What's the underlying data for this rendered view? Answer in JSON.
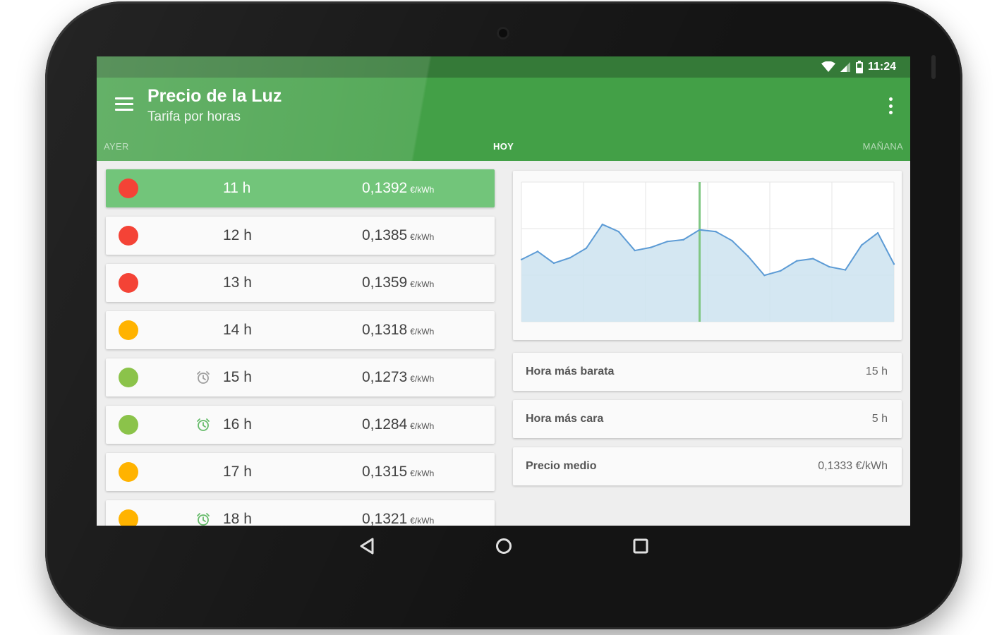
{
  "status_bar": {
    "time": "11:24",
    "icons": [
      "wifi-icon",
      "signal-icon",
      "battery-icon"
    ]
  },
  "app_bar": {
    "title": "Precio de la Luz",
    "subtitle": "Tarifa por horas",
    "menu_icon": "menu-icon",
    "overflow_icon": "more-vert-icon"
  },
  "tabs": [
    {
      "label": "AYER",
      "active": false
    },
    {
      "label": "HOY",
      "active": true
    },
    {
      "label": "MAÑANA",
      "active": false
    }
  ],
  "hours": [
    {
      "hour": "11 h",
      "price": "0,1392",
      "unit": "€/kWh",
      "level_color": "#f44336",
      "alarm": false,
      "selected": true
    },
    {
      "hour": "12 h",
      "price": "0,1385",
      "unit": "€/kWh",
      "level_color": "#f44336",
      "alarm": false,
      "selected": false
    },
    {
      "hour": "13 h",
      "price": "0,1359",
      "unit": "€/kWh",
      "level_color": "#f44336",
      "alarm": false,
      "selected": false
    },
    {
      "hour": "14 h",
      "price": "0,1318",
      "unit": "€/kWh",
      "level_color": "#ffb300",
      "alarm": false,
      "selected": false
    },
    {
      "hour": "15 h",
      "price": "0,1273",
      "unit": "€/kWh",
      "level_color": "#8bc34a",
      "alarm": true,
      "alarm_active": false,
      "selected": false
    },
    {
      "hour": "16 h",
      "price": "0,1284",
      "unit": "€/kWh",
      "level_color": "#8bc34a",
      "alarm": true,
      "alarm_active": true,
      "selected": false
    },
    {
      "hour": "17 h",
      "price": "0,1315",
      "unit": "€/kWh",
      "level_color": "#ffb300",
      "alarm": false,
      "selected": false
    },
    {
      "hour": "18 h",
      "price": "0,1321",
      "unit": "€/kWh",
      "level_color": "#ffb300",
      "alarm": true,
      "alarm_active": true,
      "selected": false
    }
  ],
  "stats": [
    {
      "label": "Hora más barata",
      "value": "15 h"
    },
    {
      "label": "Hora más cara",
      "value": "5 h"
    },
    {
      "label": "Precio medio",
      "value": "0,1333 €/kWh"
    }
  ],
  "chart_data": {
    "type": "area",
    "x": [
      0,
      1,
      2,
      3,
      4,
      5,
      6,
      7,
      8,
      9,
      10,
      11,
      12,
      13,
      14,
      15,
      16,
      17,
      18,
      19,
      20,
      21,
      22,
      23
    ],
    "values": [
      0.1278,
      0.1296,
      0.127,
      0.1282,
      0.1303,
      0.1356,
      0.134,
      0.1298,
      0.1305,
      0.1318,
      0.1322,
      0.1344,
      0.134,
      0.132,
      0.1285,
      0.1243,
      0.1253,
      0.1275,
      0.128,
      0.1262,
      0.1255,
      0.131,
      0.1337,
      0.1268
    ],
    "ylim": [
      0.114,
      0.145
    ],
    "highlight_x": 11,
    "grid": true,
    "line_color": "#5c9bd5",
    "fill_color": "#cde3f0",
    "highlight_color": "#81c784"
  },
  "nav_bar": [
    "back-icon",
    "home-icon",
    "recents-icon"
  ]
}
